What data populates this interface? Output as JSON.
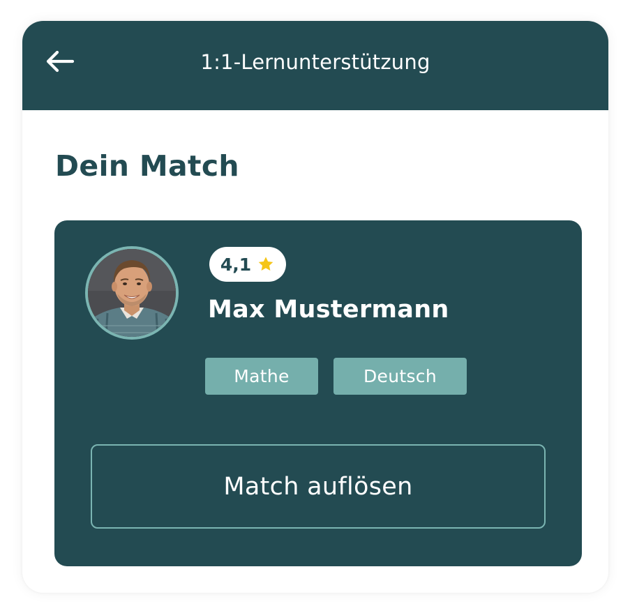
{
  "header": {
    "title": "1:1-Lernunterstützung",
    "back_icon": "arrow-left-icon"
  },
  "section": {
    "title": "Dein Match"
  },
  "match": {
    "rating": "4,1",
    "rating_icon": "star-icon",
    "name": "Max Mustermann",
    "subjects": [
      "Mathe",
      "Deutsch"
    ],
    "dissolve_label": "Match auflösen"
  },
  "colors": {
    "primary": "#234b52",
    "accent": "#7bb5b2",
    "tag": "#75afac",
    "star": "#f5c518",
    "background": "#ffffff"
  }
}
